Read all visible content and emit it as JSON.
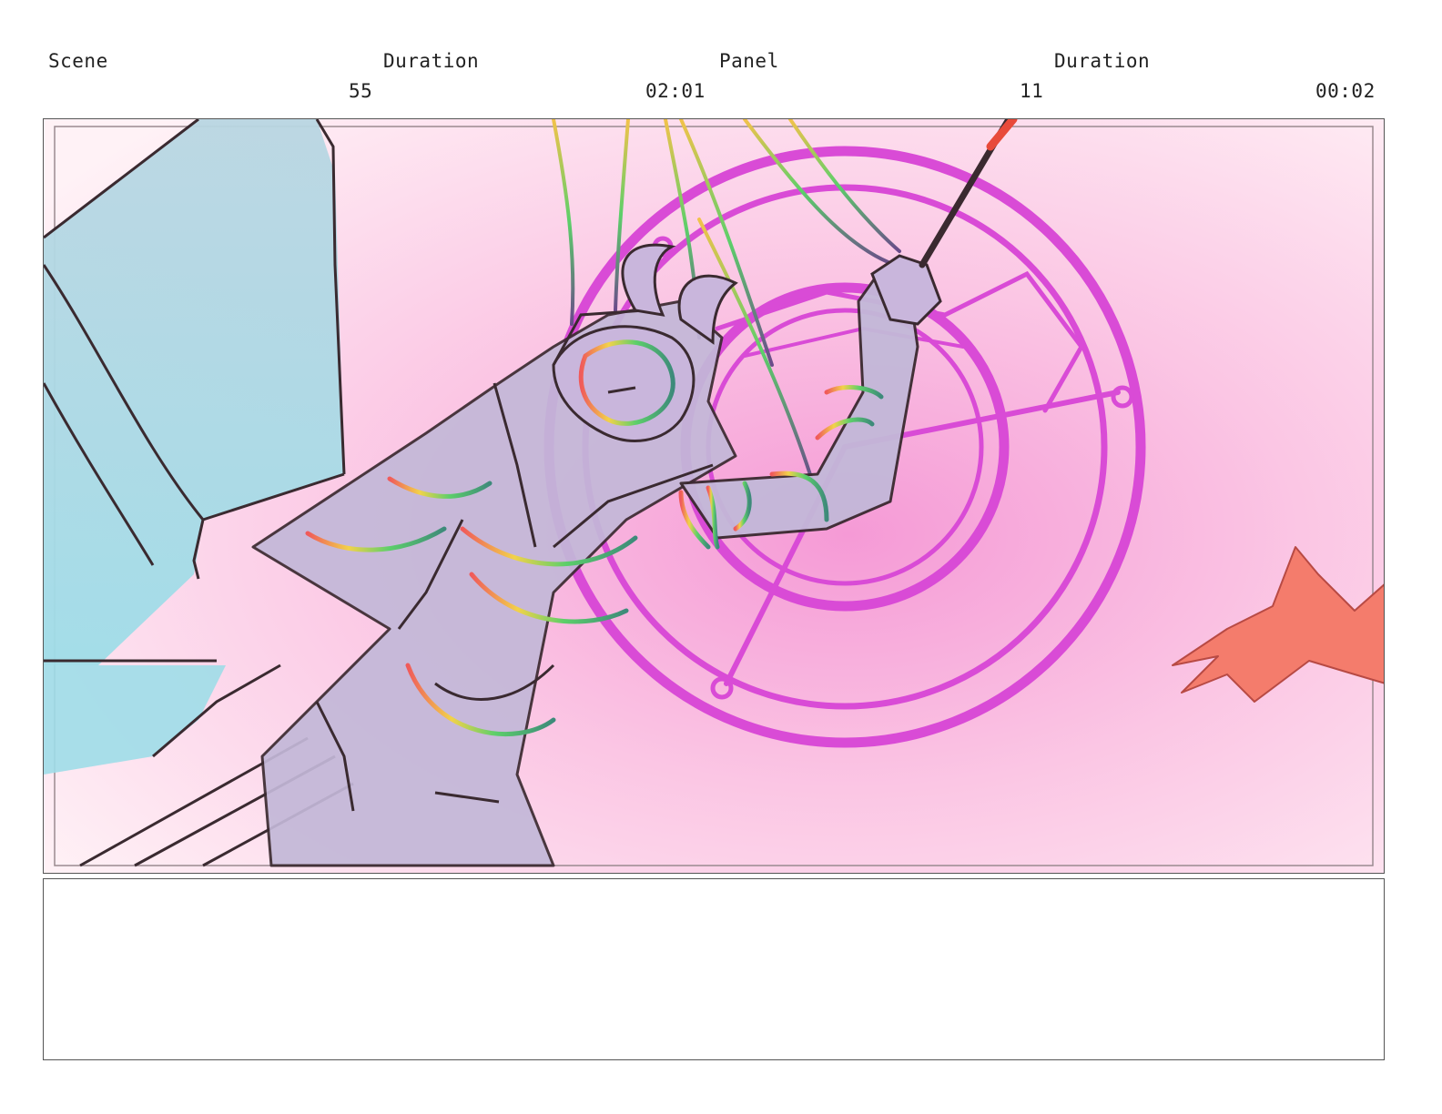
{
  "header": {
    "scene_label": "Scene",
    "scene_value": "55",
    "scene_duration_label": "Duration",
    "scene_duration_value": "02:01",
    "panel_label": "Panel",
    "panel_value": "11",
    "panel_duration_label": "Duration",
    "panel_duration_value": "00:02"
  },
  "artwork": {
    "subject": "demon-figure-with-magic-circle",
    "colors": {
      "background_pink": "#f7b6dc",
      "wing_blue": "#a9d8e6",
      "figure_lavender": "#c7b4dc",
      "circle_magenta": "#d94bd6",
      "hand_coral": "#f47c6c",
      "line": "#3a2a30"
    }
  },
  "notes": {
    "text": ""
  }
}
